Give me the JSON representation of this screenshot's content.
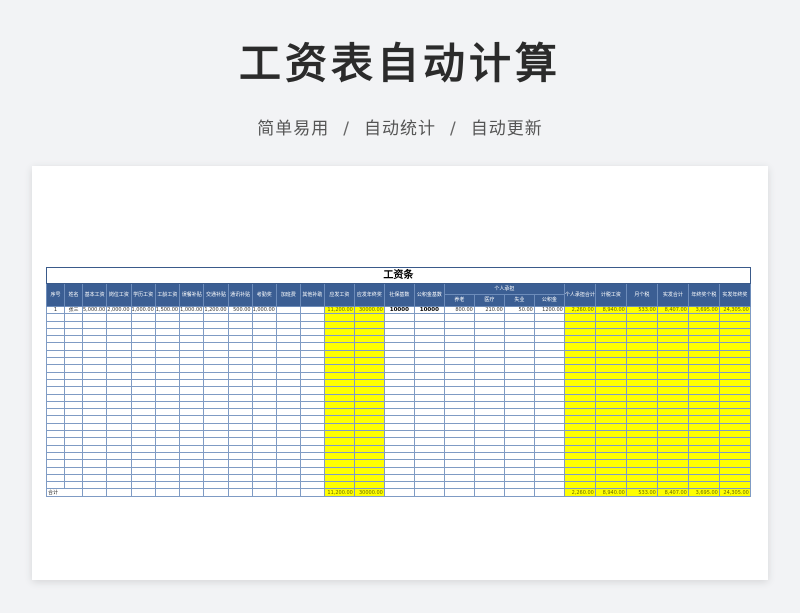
{
  "header": {
    "title": "工资表自动计算",
    "subtitle": [
      "简单易用",
      "自动统计",
      "自动更新"
    ],
    "separator": "/"
  },
  "sheet": {
    "caption": "工资条",
    "group_header": "个人承担",
    "columns": [
      "序号",
      "姓名",
      "基本工资",
      "岗位工资",
      "学历工资",
      "工龄工资",
      "误餐补贴",
      "交通补贴",
      "通讯补贴",
      "考勤奖",
      "加班费",
      "其他补助",
      "应发工资",
      "应发年终奖",
      "社保基数",
      "公积金基数",
      "养老",
      "医疗",
      "失业",
      "公积金",
      "个人承担合计",
      "计税工资",
      "月个税",
      "实发合计",
      "年终奖个税",
      "实发年终奖"
    ],
    "row1": [
      "1",
      "张三",
      "5,000.00",
      "2,000.00",
      "1,000.00",
      "1,500.00",
      "1,000.00",
      "1,200.00",
      "500.00",
      "1,000.00",
      "",
      "",
      "11,200.00",
      "30000.00",
      "10000",
      "10000",
      "800.00",
      "210.00",
      "50.00",
      "1200.00",
      "2,260.00",
      "8,940.00",
      "533.00",
      "8,407.00",
      "3,695.00",
      "24,305.00"
    ],
    "total_label": "合计",
    "total": {
      "gross": "11,200.00",
      "bonus": "30000.00",
      "personal": "2,260.00",
      "taxable": "8,940.00",
      "tax": "533.00",
      "net": "8,407.00",
      "bonus_tax": "3,695.00",
      "net_bonus": "24,305.00"
    }
  }
}
